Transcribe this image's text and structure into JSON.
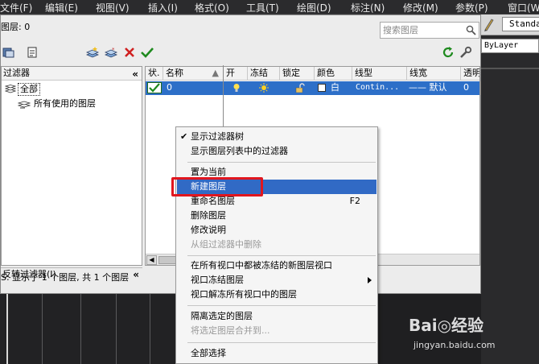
{
  "menubar": {
    "items": [
      "文件(F)",
      "编辑(E)",
      "视图(V)",
      "插入(I)",
      "格式(O)",
      "工具(T)",
      "绘图(D)",
      "标注(N)",
      "修改(M)",
      "参数(P)",
      "窗口(W"
    ]
  },
  "right": {
    "standard_label": "Standa",
    "bylayer_label": "ByLayer"
  },
  "dialog": {
    "title": "图层: 0",
    "search_placeholder": "搜索图层",
    "filter_header": "过滤器",
    "filter_all": "全部",
    "filter_used": "所有使用的图层",
    "invert_filter": "反转过滤器(I)",
    "status_text": "S: 显示了 1 个图层, 共 1 个图层",
    "columns": [
      "状.",
      "名称",
      "开",
      "冻结",
      "锁定",
      "颜色",
      "线型",
      "线宽",
      "透明"
    ],
    "row": {
      "name": "0",
      "color": "白",
      "linetype": "Contin...",
      "lineweight": "—— 默认",
      "transparency": "0"
    }
  },
  "context_menu": {
    "items": [
      {
        "label": "显示过滤器树",
        "checked": true,
        "disabled": false
      },
      {
        "label": "显示图层列表中的过滤器",
        "checked": false,
        "disabled": false
      },
      {
        "label": "置为当前",
        "checked": false,
        "disabled": false
      },
      {
        "label": "新建图层",
        "checked": false,
        "disabled": false,
        "highlighted": true
      },
      {
        "label": "重命名图层",
        "checked": false,
        "disabled": false,
        "shortcut": "F2"
      },
      {
        "label": "删除图层",
        "checked": false,
        "disabled": false
      },
      {
        "label": "修改说明",
        "checked": false,
        "disabled": false
      },
      {
        "label": "从组过滤器中删除",
        "checked": false,
        "disabled": true
      },
      {
        "label": "在所有视口中都被冻结的新图层视口",
        "checked": false,
        "disabled": false
      },
      {
        "label": "视口冻结图层",
        "checked": false,
        "disabled": false,
        "submenu": true
      },
      {
        "label": "视口解冻所有视口中的图层",
        "checked": false,
        "disabled": false
      },
      {
        "label": "隔离选定的图层",
        "checked": false,
        "disabled": false
      },
      {
        "label": "将选定图层合并到...",
        "checked": false,
        "disabled": true
      },
      {
        "label": "全部选择",
        "checked": false,
        "disabled": false
      }
    ]
  },
  "watermark": {
    "logo": "Bai◎经验",
    "url": "jingyan.baidu.com"
  },
  "colors": {
    "selection_blue": "#2d6fc8",
    "highlight_red": "#e0161e",
    "menubar_bg": "#2b2b2d"
  }
}
